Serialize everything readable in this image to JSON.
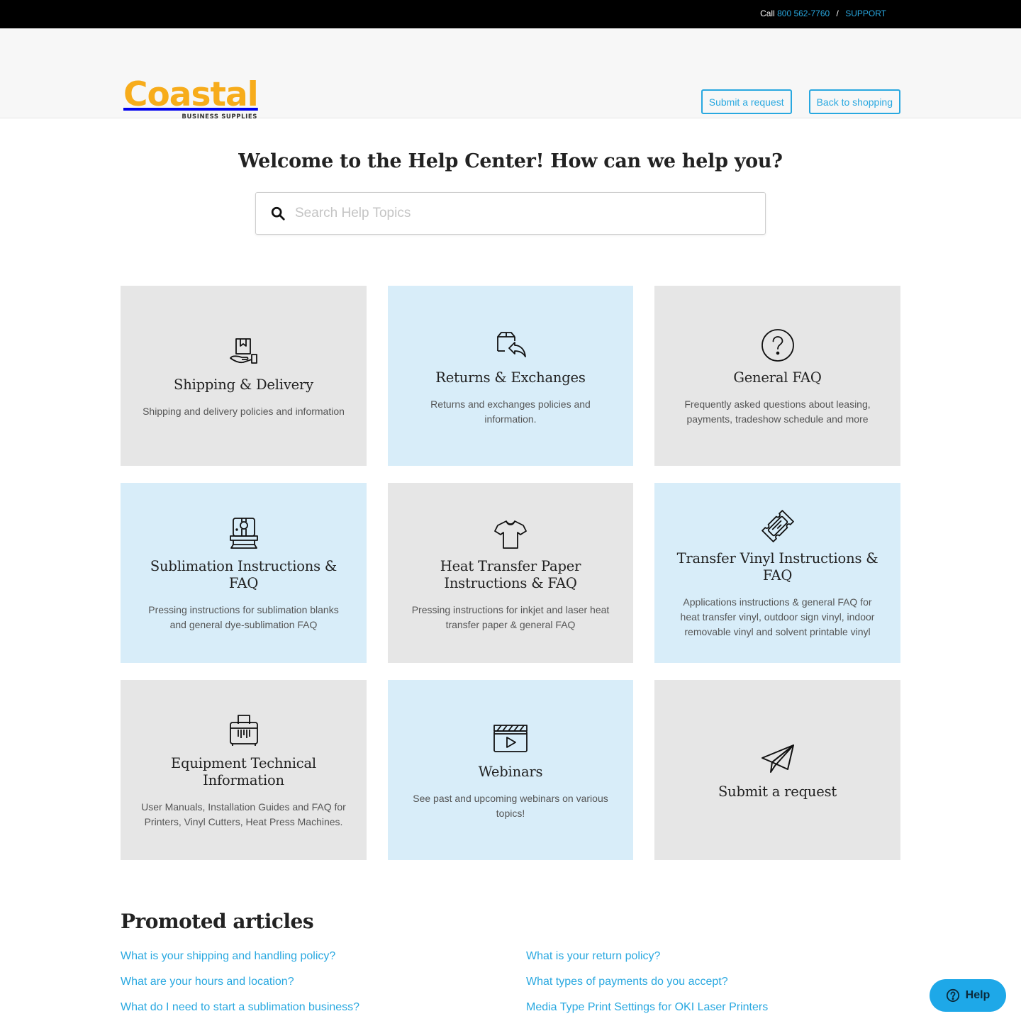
{
  "topbar": {
    "call_label": "Call",
    "phone": "800 562-7760",
    "separator": "/",
    "support_label": "SUPPORT"
  },
  "header": {
    "logo_word": "Coastal",
    "logo_sub": "BUSINESS SUPPLIES",
    "submit_request_label": "Submit a request",
    "back_to_shopping_label": "Back to shopping"
  },
  "hero": {
    "title": "Welcome to the Help Center! How can we help you?",
    "search_placeholder": "Search Help Topics",
    "search_value": ""
  },
  "colors": {
    "accent": "#29a8e0",
    "logo": "#f7ac1b",
    "card_grey": "#e6e6e6",
    "card_blue": "#d8edf9",
    "help_widget": "#1ea8e8"
  },
  "categories": [
    {
      "icon": "hand-box-icon",
      "title": "Shipping & Delivery",
      "description": "Shipping and delivery policies and information",
      "tint": "grey"
    },
    {
      "icon": "box-return-icon",
      "title": "Returns & Exchanges",
      "description": "Returns and exchanges policies and information.",
      "tint": "blue"
    },
    {
      "icon": "question-circle-icon",
      "title": "General FAQ",
      "description": "Frequently asked questions about leasing, payments, tradeshow schedule and more",
      "tint": "grey"
    },
    {
      "icon": "instant-camera-icon",
      "title": "Sublimation Instructions & FAQ",
      "description": "Pressing instructions for sublimation blanks and general dye-sublimation FAQ",
      "tint": "blue"
    },
    {
      "icon": "tshirt-icon",
      "title": "Heat Transfer Paper Instructions & FAQ",
      "description": "Pressing instructions for inkjet and laser heat transfer paper & general FAQ",
      "tint": "grey"
    },
    {
      "icon": "ticket-icon",
      "title": "Transfer Vinyl Instructions & FAQ",
      "description": "Applications instructions & general FAQ for heat transfer vinyl, outdoor sign vinyl, indoor removable vinyl and solvent printable vinyl",
      "tint": "blue"
    },
    {
      "icon": "shredder-printer-icon",
      "title": "Equipment Technical Information",
      "description": "User Manuals, Installation Guides and FAQ for Printers, Vinyl Cutters, Heat Press Machines.",
      "tint": "grey"
    },
    {
      "icon": "video-clapper-icon",
      "title": "Webinars",
      "description": "See past and upcoming webinars on various topics!",
      "tint": "blue"
    },
    {
      "icon": "paper-plane-icon",
      "title": "Submit a request",
      "description": "",
      "tint": "grey"
    }
  ],
  "promoted": {
    "title": "Promoted articles",
    "articles": [
      "What is your shipping and handling policy?",
      "What is your return policy?",
      "What are your hours and location?",
      "What types of payments do you accept?",
      "What do I need to start a sublimation business?",
      "Media Type Print Settings for OKI Laser Printers"
    ]
  },
  "help_widget": {
    "label": "Help"
  }
}
